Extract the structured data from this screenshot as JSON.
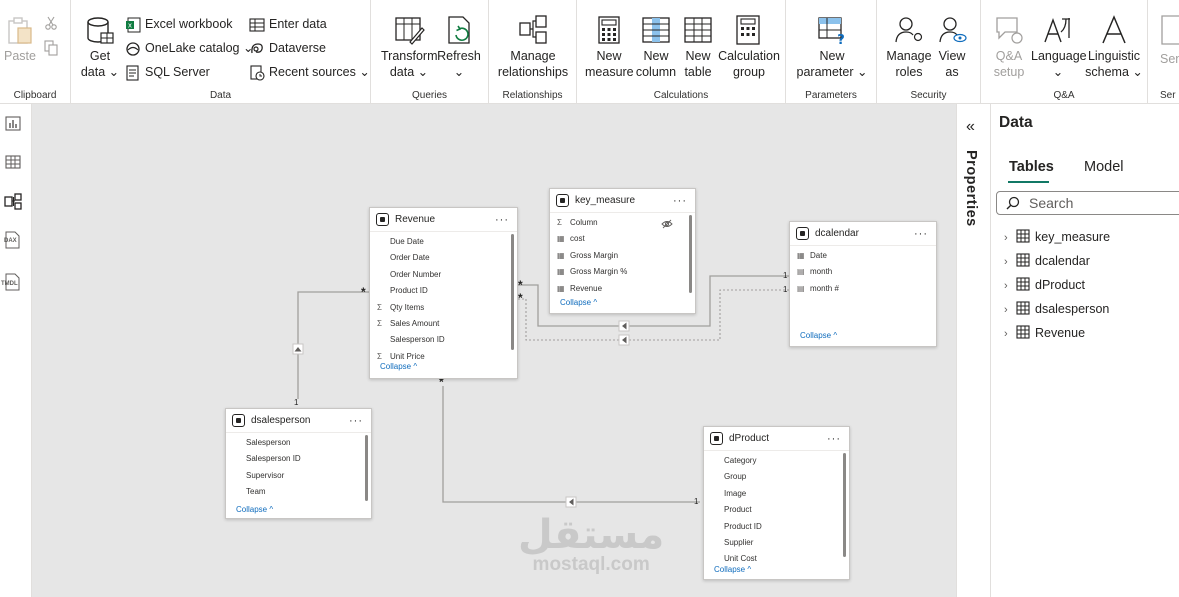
{
  "ribbon": {
    "groups": {
      "clipboard": "Clipboard",
      "data": "Data",
      "queries": "Queries",
      "relationships": "Relationships",
      "calculations": "Calculations",
      "parameters": "Parameters",
      "security": "Security",
      "qa": "Q&A",
      "sensitivity": "Ser"
    },
    "paste": "Paste",
    "get_data": [
      "Get",
      "data ⌄"
    ],
    "excel_workbook": "Excel workbook",
    "onelake_catalog": "OneLake catalog ⌄",
    "sql_server": "SQL Server",
    "enter_data": "Enter data",
    "dataverse": "Dataverse",
    "recent_sources": "Recent sources ⌄",
    "transform_data": [
      "Transform",
      "data ⌄"
    ],
    "refresh": [
      "Refresh",
      "⌄"
    ],
    "manage_relationships": [
      "Manage",
      "relationships"
    ],
    "new_measure": [
      "New",
      "measure"
    ],
    "new_column": [
      "New",
      "column"
    ],
    "new_table": [
      "New",
      "table"
    ],
    "calculation_group": [
      "Calculation",
      "group"
    ],
    "new_parameter": [
      "New",
      "parameter ⌄"
    ],
    "manage_roles": [
      "Manage",
      "roles"
    ],
    "view_as": [
      "View",
      "as"
    ],
    "qa_setup": [
      "Q&A",
      "setup"
    ],
    "language": [
      "Language",
      "⌄"
    ],
    "linguistic_schema": [
      "Linguistic",
      "schema ⌄"
    ],
    "sensitivity": "Sen"
  },
  "rail": {
    "icons": [
      "report-view-icon",
      "table-view-icon",
      "model-view-icon",
      "dax-query-icon",
      "tmdl-view-icon"
    ],
    "dax_label": "DAX",
    "tmdl_label": "TMDL"
  },
  "tables": {
    "revenue": {
      "title": "Revenue",
      "fields": [
        {
          "name": "Due Date",
          "icon": ""
        },
        {
          "name": "Order Date",
          "icon": ""
        },
        {
          "name": "Order Number",
          "icon": ""
        },
        {
          "name": "Product ID",
          "icon": ""
        },
        {
          "name": "Qty Items",
          "icon": "Σ"
        },
        {
          "name": "Sales Amount",
          "icon": "Σ"
        },
        {
          "name": "Salesperson ID",
          "icon": ""
        },
        {
          "name": "Unit Price",
          "icon": "Σ"
        }
      ],
      "collapse": "Collapse ^"
    },
    "key_measure": {
      "title": "key_measure",
      "fields": [
        {
          "name": "Column",
          "icon": "Σ"
        },
        {
          "name": "cost",
          "icon": "▦"
        },
        {
          "name": "Gross Margin",
          "icon": "▦"
        },
        {
          "name": "Gross Margin %",
          "icon": "▦"
        },
        {
          "name": "Revenue",
          "icon": "▦"
        }
      ],
      "collapse": "Collapse ^"
    },
    "dcalendar": {
      "title": "dcalendar",
      "fields": [
        {
          "name": "Date",
          "icon": "▦"
        },
        {
          "name": "month",
          "icon": "▤"
        },
        {
          "name": "month #",
          "icon": "▤"
        }
      ],
      "collapse": "Collapse ^"
    },
    "dsalesperson": {
      "title": "dsalesperson",
      "fields": [
        {
          "name": "Salesperson",
          "icon": ""
        },
        {
          "name": "Salesperson ID",
          "icon": ""
        },
        {
          "name": "Supervisor",
          "icon": ""
        },
        {
          "name": "Team",
          "icon": ""
        }
      ],
      "collapse": "Collapse ^"
    },
    "dproduct": {
      "title": "dProduct",
      "fields": [
        {
          "name": "Category",
          "icon": ""
        },
        {
          "name": "Group",
          "icon": ""
        },
        {
          "name": "Image",
          "icon": ""
        },
        {
          "name": "Product",
          "icon": ""
        },
        {
          "name": "Product ID",
          "icon": ""
        },
        {
          "name": "Supplier",
          "icon": ""
        },
        {
          "name": "Unit Cost",
          "icon": ""
        }
      ],
      "collapse": "Collapse ^"
    }
  },
  "relationships": {
    "many": "*",
    "one": "1"
  },
  "properties": {
    "label": "Properties",
    "collapse_icon": "«"
  },
  "data_pane": {
    "title": "Data",
    "tabs": [
      "Tables",
      "Model"
    ],
    "search_placeholder": "Search",
    "items": [
      "key_measure",
      "dcalendar",
      "dProduct",
      "dsalesperson",
      "Revenue"
    ]
  },
  "watermark": {
    "arabic": "مستقل",
    "latin": "mostaql.com"
  },
  "colors": {
    "accent": "#117865",
    "canvas": "#e6e6e6",
    "link": "#0f6cbd"
  }
}
